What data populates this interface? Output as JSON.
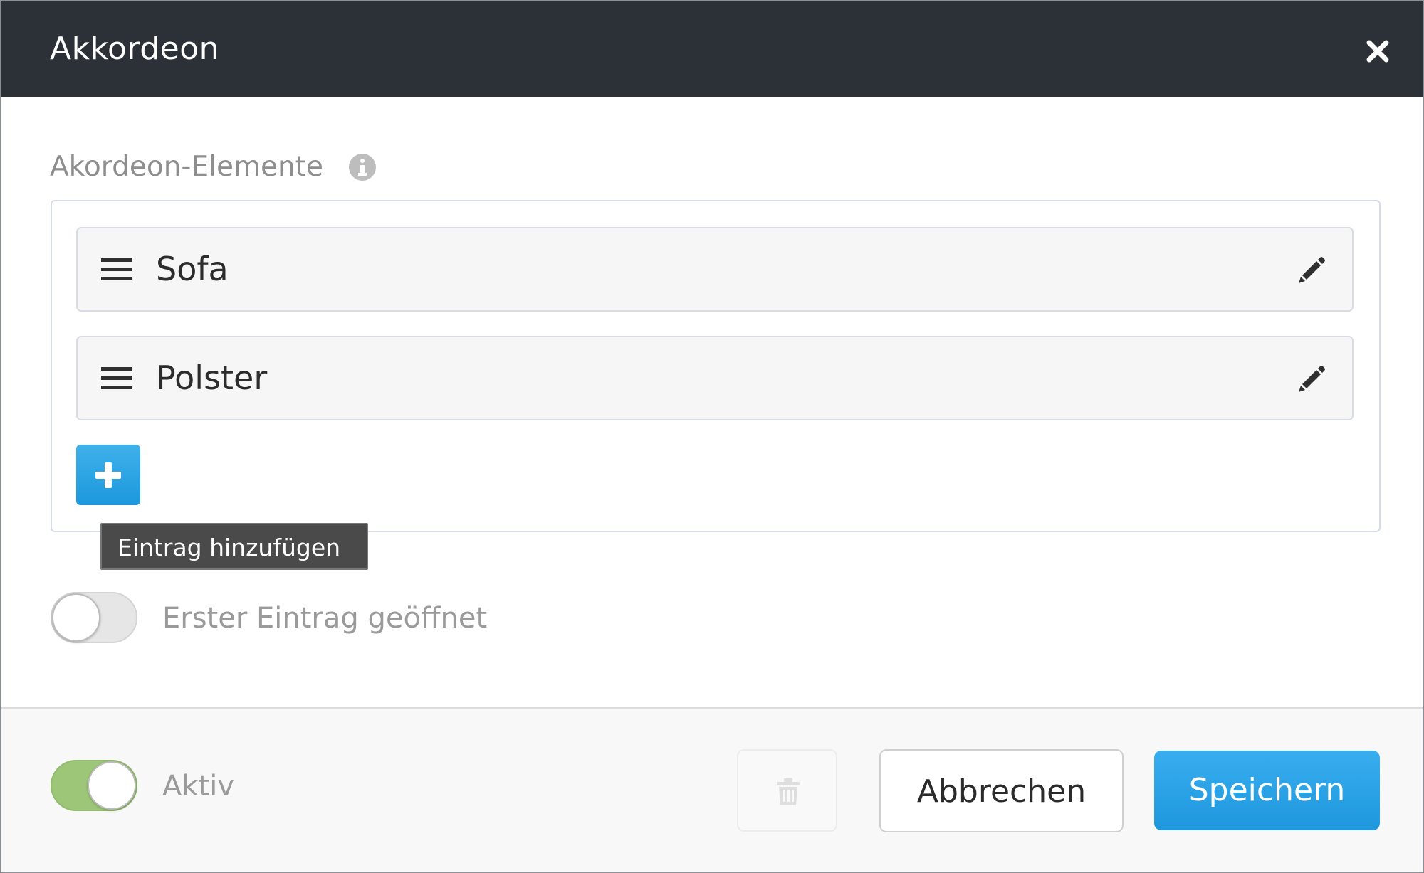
{
  "dialog": {
    "title": "Akkordeon"
  },
  "section": {
    "label": "Akordeon-Elemente"
  },
  "entries": [
    {
      "label": "Sofa"
    },
    {
      "label": "Polster"
    }
  ],
  "add_button": {
    "tooltip": "Eintrag hinzufügen"
  },
  "first_entry_toggle": {
    "label": "Erster Eintrag geöffnet",
    "enabled": false
  },
  "active_toggle": {
    "label": "Aktiv",
    "enabled": true
  },
  "footer": {
    "cancel_label": "Abbrechen",
    "save_label": "Speichern"
  },
  "colors": {
    "header_background": "#2c3037",
    "accent": "#1f97dd",
    "toggle_on": "#9ec678"
  },
  "icons": [
    "close-icon",
    "info-icon",
    "drag-handle-icon",
    "pencil-icon",
    "plus-icon",
    "trash-icon"
  ]
}
